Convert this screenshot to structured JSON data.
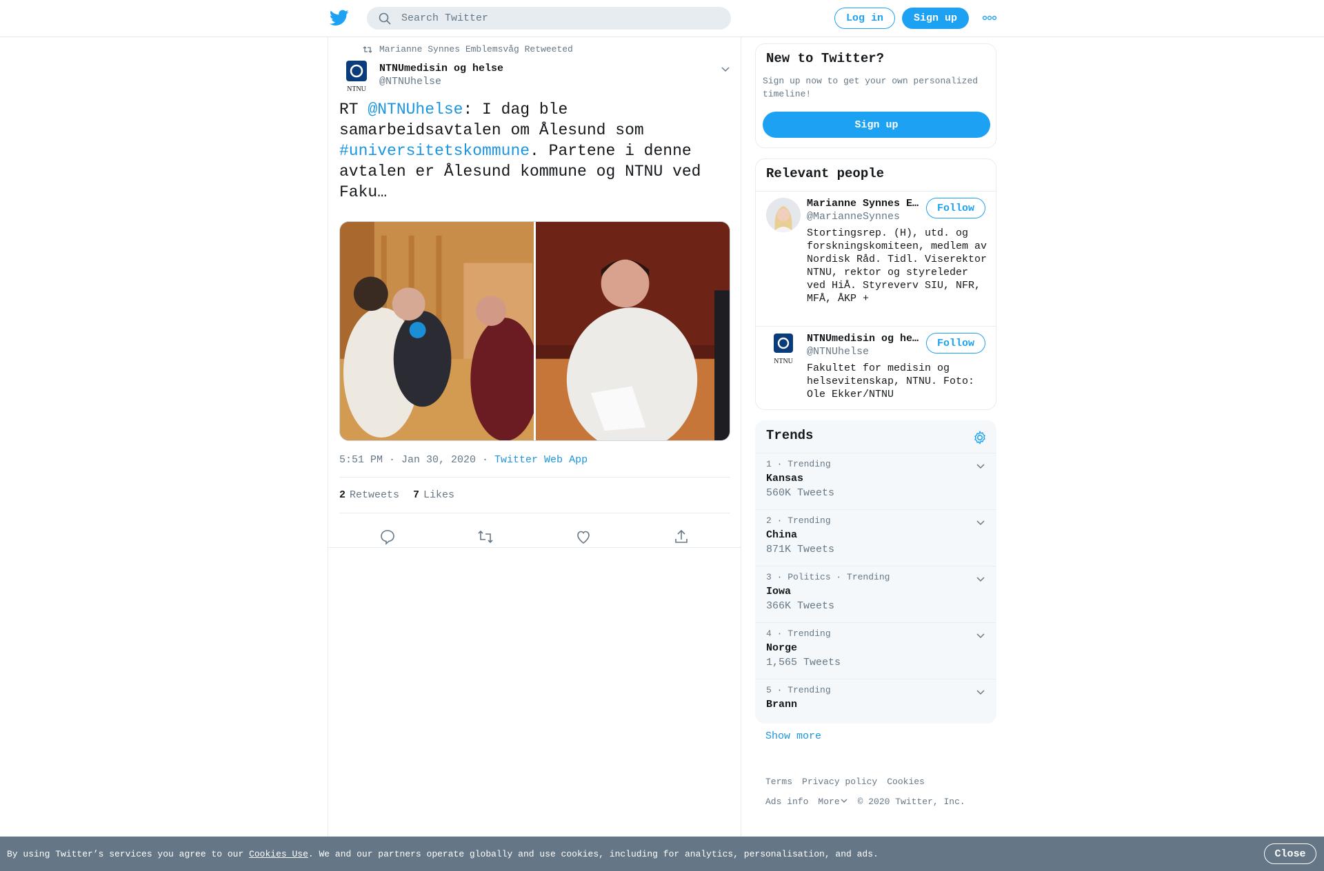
{
  "header": {
    "search_placeholder": "Search Twitter",
    "login_label": "Log in",
    "signup_label": "Sign up",
    "icons": [
      "twitter-bird-icon",
      "search-icon",
      "more-dots-icon"
    ]
  },
  "tweet": {
    "retweeted_by": "Marianne Synnes Emblemsvåg Retweeted",
    "author_name": "NTNUmedisin og helse",
    "author_handle": "@NTNUhelse",
    "text_parts": {
      "p1": "RT ",
      "mention": "@NTNUhelse",
      "p2": ": I dag ble samarbeidsavtalen om Ålesund som ",
      "hashtag": "#universitetskommune",
      "p3": ". Partene i denne avtalen er Ålesund kommune og NTNU ved Faku…"
    },
    "time": "5:51 PM · Jan 30, 2020 · ",
    "source": "Twitter Web App",
    "retweets_count": "2",
    "retweets_label": "Retweets",
    "likes_count": "7",
    "likes_label": "Likes",
    "actions": [
      "reply-icon",
      "retweet-icon",
      "like-icon",
      "share-icon"
    ]
  },
  "sidebar": {
    "new_to_twitter": {
      "title": "New to Twitter?",
      "subtitle": "Sign up now to get your own personalized timeline!",
      "button": "Sign up"
    },
    "relevant_people": {
      "title": "Relevant people",
      "people": [
        {
          "name": "Marianne Synnes E…",
          "handle": "@MarianneSynnes",
          "bio": "Stortingsrep. (H), utd. og forskningskomiteen, medlem av Nordisk Råd. Tidl. Viserektor NTNU, rektor og styreleder ved HiÅ. Styreverv SIU, NFR, MFÅ, ÅKP +",
          "follow": "Follow"
        },
        {
          "name": "NTNUmedisin og he…",
          "handle": "@NTNUhelse",
          "bio": "Fakultet for medisin og helsevitenskap, NTNU. Foto: Ole Ekker/NTNU",
          "follow": "Follow"
        }
      ]
    },
    "trends": {
      "title": "Trends",
      "items": [
        {
          "meta": "1 · Trending",
          "name": "Kansas",
          "count": "560K Tweets"
        },
        {
          "meta": "2 · Trending",
          "name": "China",
          "count": "871K Tweets"
        },
        {
          "meta": "3 · Politics · Trending",
          "name": "Iowa",
          "count": "366K Tweets"
        },
        {
          "meta": "4 · Trending",
          "name": "Norge",
          "count": "1,565 Tweets"
        },
        {
          "meta": "5 · Trending",
          "name": "Brann",
          "count": ""
        }
      ],
      "show_more": "Show more"
    },
    "footer": {
      "terms": "Terms",
      "privacy": "Privacy policy",
      "cookies": "Cookies",
      "ads": "Ads info",
      "more": "More",
      "copyright": "© 2020 Twitter, Inc."
    }
  },
  "cookie_bar": {
    "text_before": "By using Twitter’s services you agree to our ",
    "link": "Cookies Use",
    "text_after": ". We and our partners operate globally and use cookies, including for analytics, personalisation, and ads.",
    "close": "Close"
  },
  "colors": {
    "accent": "#1da1f2",
    "link": "#1b95e0",
    "muted": "#657786",
    "cookie_bar": "#657786"
  }
}
